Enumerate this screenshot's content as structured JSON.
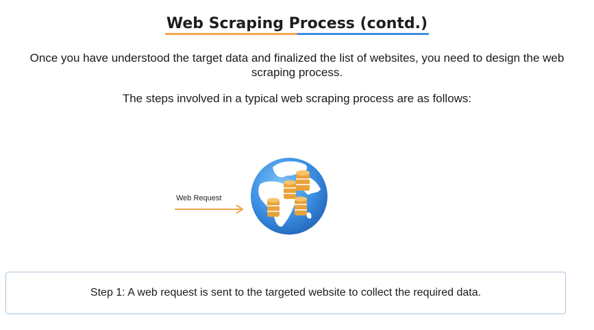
{
  "slide": {
    "title": "Web Scraping Process (contd.)",
    "intro": "Once you have understood the target data and finalized the list of websites, you need to design the web scraping process.",
    "steps_intro": "The steps involved in a typical web scraping process are as follows:"
  },
  "diagram": {
    "arrow_label": "Web Request",
    "globe_icon": "globe-icon",
    "database_icon": "database-stack-icon",
    "colors": {
      "arrow": "#f0a64a",
      "ocean": "#3d8fe0",
      "land": "#ffffff",
      "coins": "#e9a23b"
    }
  },
  "step": {
    "text": "Step 1: A web request is sent to the targeted website to collect the required data."
  },
  "colors": {
    "title_underline_left": "#f0a64a",
    "title_underline_right": "#3d8fe0",
    "box_border": "#a9c4df"
  }
}
